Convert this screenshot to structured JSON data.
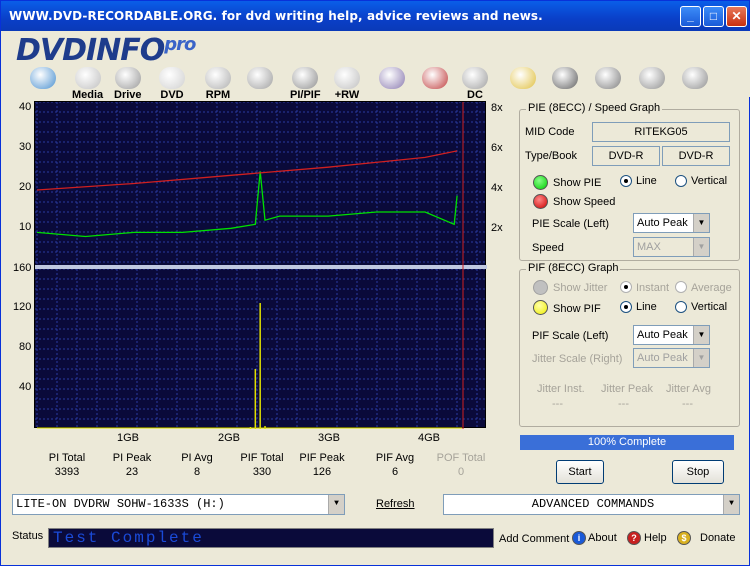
{
  "window": {
    "title": "WWW.DVD-RECORDABLE.ORG.   for dvd writing help, advice reviews and news.",
    "minimize": "_",
    "maximize": "□",
    "close": "✕"
  },
  "logo": {
    "text": "DVDINFO",
    "suffix": "pro"
  },
  "toolbar": [
    {
      "label": "",
      "icon": "monitor-icon"
    },
    {
      "label": "Media",
      "icon": "disc-icon"
    },
    {
      "label": "Drive",
      "icon": "drive-icon"
    },
    {
      "label": "DVD",
      "icon": "dvd-icon"
    },
    {
      "label": "RPM",
      "icon": "rpm-icon"
    },
    {
      "label": "",
      "icon": "magnify-icon"
    },
    {
      "label": "PI/PIF",
      "icon": "pi-pif-icon"
    },
    {
      "label": "+RW",
      "icon": "rw-icon"
    },
    {
      "label": "",
      "icon": "book-icon"
    },
    {
      "label": "",
      "icon": "burn-icon"
    },
    {
      "label": "DC",
      "icon": "dc-icon"
    },
    {
      "label": "",
      "icon": "clipboard-icon"
    },
    {
      "label": "",
      "icon": "camera-icon"
    },
    {
      "label": "",
      "icon": "notes-icon"
    },
    {
      "label": "",
      "icon": "play-pause-icon"
    },
    {
      "label": "",
      "icon": "stop-icon"
    }
  ],
  "graph": {
    "pie_y_ticks": [
      "40",
      "30",
      "20",
      "10"
    ],
    "speed_ticks": [
      "8x",
      "6x",
      "4x",
      "2x"
    ],
    "pif_y_ticks": [
      "160",
      "120",
      "80",
      "40"
    ],
    "x_ticks": [
      "1GB",
      "2GB",
      "3GB",
      "4GB"
    ]
  },
  "chart_data": [
    {
      "type": "line",
      "title": "",
      "ylim": [
        0,
        40
      ],
      "y2lim": [
        0,
        10
      ],
      "x_range_gb": [
        0,
        4.38
      ],
      "series": [
        {
          "name": "PIE",
          "color": "#00e000",
          "x": [
            0.0,
            0.5,
            1.0,
            1.5,
            2.0,
            2.25,
            2.3,
            2.35,
            2.5,
            3.0,
            3.5,
            4.0,
            4.3,
            4.33
          ],
          "y": [
            8,
            7,
            8,
            8,
            9,
            10,
            23,
            11,
            12,
            12,
            13,
            13,
            10,
            17
          ]
        },
        {
          "name": "Speed",
          "color": "#d02020",
          "x": [
            0.0,
            1.0,
            2.0,
            3.0,
            4.0,
            4.33
          ],
          "y": [
            4.6,
            5.0,
            5.5,
            6.0,
            6.6,
            7.0
          ]
        }
      ]
    },
    {
      "type": "bar",
      "ylim": [
        0,
        160
      ],
      "series": [
        {
          "name": "PIF",
          "color": "#e0e000",
          "x": [
            2.2,
            2.25,
            2.3,
            2.35
          ],
          "y": [
            2,
            60,
            126,
            3
          ]
        }
      ]
    }
  ],
  "pie_panel": {
    "legend": "PIE (8ECC) / Speed Graph",
    "mid_code_label": "MID Code",
    "mid_code": "RITEKG05",
    "type_book_label": "Type/Book",
    "type": "DVD-R",
    "book": "DVD-R",
    "show_pie": "Show PIE",
    "show_speed": "Show Speed",
    "line": "Line",
    "vertical": "Vertical",
    "pie_scale_label": "PIE Scale (Left)",
    "pie_scale": "Auto Peak",
    "speed_label": "Speed",
    "speed": "MAX"
  },
  "pif_panel": {
    "legend": "PIF (8ECC) Graph",
    "show_jitter": "Show Jitter",
    "instant": "Instant",
    "average": "Average",
    "show_pif": "Show PIF",
    "line": "Line",
    "vertical": "Vertical",
    "pif_scale_label": "PIF Scale (Left)",
    "pif_scale": "Auto Peak",
    "jitter_scale_label": "Jitter Scale (Right)",
    "jitter_scale": "Auto Peak",
    "jitter_inst_label": "Jitter Inst.",
    "jitter_peak_label": "Jitter Peak",
    "jitter_avg_label": "Jitter Avg",
    "jitter_inst": "---",
    "jitter_peak": "---",
    "jitter_avg": "---"
  },
  "progress": {
    "text": "100% Complete",
    "value": 1.0
  },
  "stats": [
    {
      "label": "PI Total",
      "value": "3393"
    },
    {
      "label": "PI Peak",
      "value": "23"
    },
    {
      "label": "PI Avg",
      "value": "8"
    },
    {
      "label": "PIF Total",
      "value": "330"
    },
    {
      "label": "PIF Peak",
      "value": "126"
    },
    {
      "label": "PIF Avg",
      "value": "6"
    },
    {
      "label": "POF Total",
      "value": "0"
    }
  ],
  "buttons": {
    "start": "Start",
    "stop": "Stop"
  },
  "drive_select": "LITE-ON DVDRW SOHW-1633S (H:)",
  "refresh": "Refresh",
  "advanced": "ADVANCED COMMANDS",
  "status_label": "Status",
  "status_text": "Test Complete",
  "footer": {
    "add_comment": "Add Comment",
    "about": "About",
    "help": "Help",
    "donate": "Donate"
  },
  "colors": {
    "plot_bg": "#0a0a3a",
    "pie": "#00e000",
    "speed": "#d02020",
    "pif": "#e0e000",
    "progress": "#3a6fd8"
  }
}
